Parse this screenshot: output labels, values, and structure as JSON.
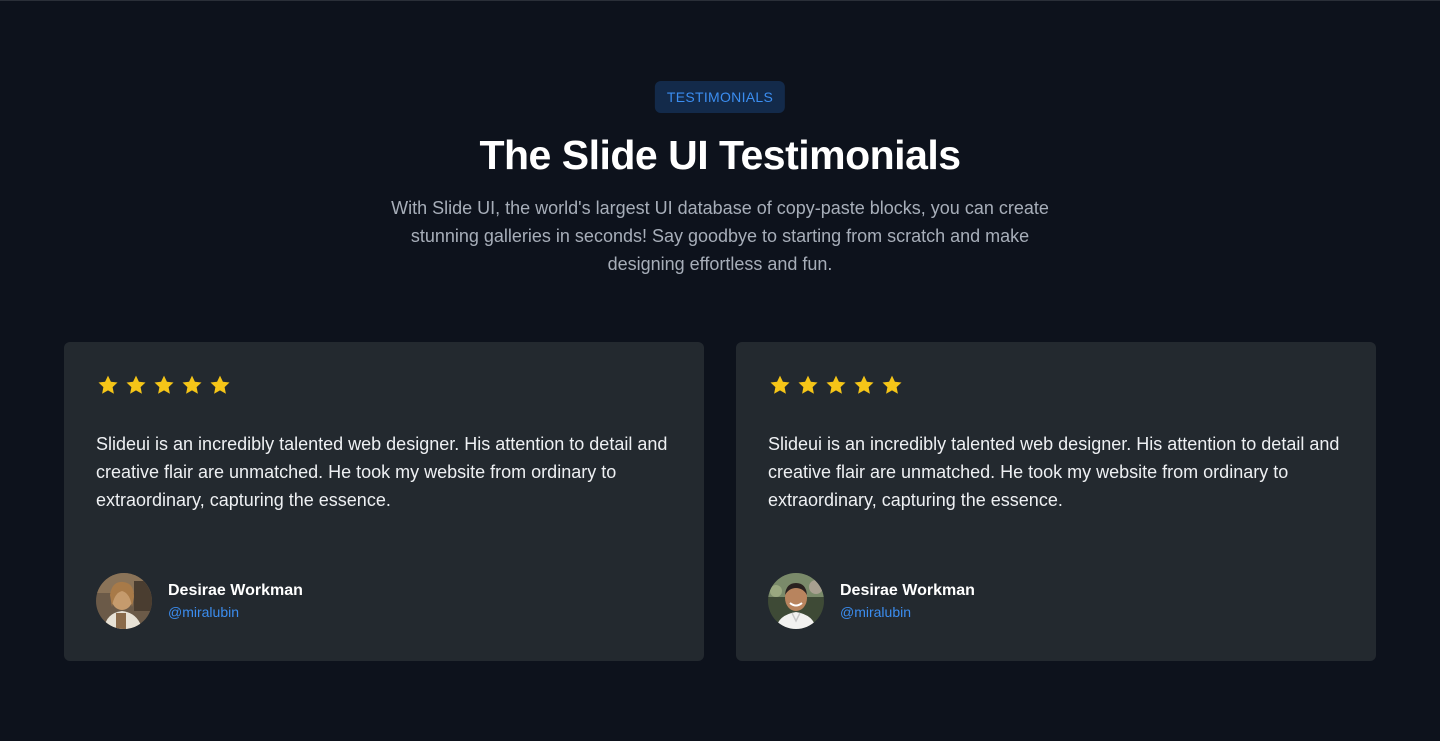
{
  "header": {
    "badge": "TESTIMONIALS",
    "title": "The Slide UI Testimonials",
    "subtitle": "With Slide UI, the world's largest UI database of copy-paste blocks, you can create stunning galleries in seconds! Say goodbye to starting from scratch and make designing effortless and fun."
  },
  "colors": {
    "background": "#0d121c",
    "card": "#23292f",
    "accent": "#3b8df0",
    "badge_bg": "#132a4a",
    "star": "#f5c518"
  },
  "testimonials": [
    {
      "rating": 5,
      "quote": "Slideui is an incredibly talented web designer. His attention to detail and creative flair are unmatched. He took my website from ordinary to extraordinary, capturing the essence.",
      "name": "Desirae Workman",
      "handle": "@miralubin",
      "avatar_icon": "woman-portrait-avatar"
    },
    {
      "rating": 5,
      "quote": "Slideui is an incredibly talented web designer. His attention to detail and creative flair are unmatched. He took my website from ordinary to extraordinary, capturing the essence.",
      "name": "Desirae Workman",
      "handle": "@miralubin",
      "avatar_icon": "man-portrait-avatar"
    }
  ]
}
